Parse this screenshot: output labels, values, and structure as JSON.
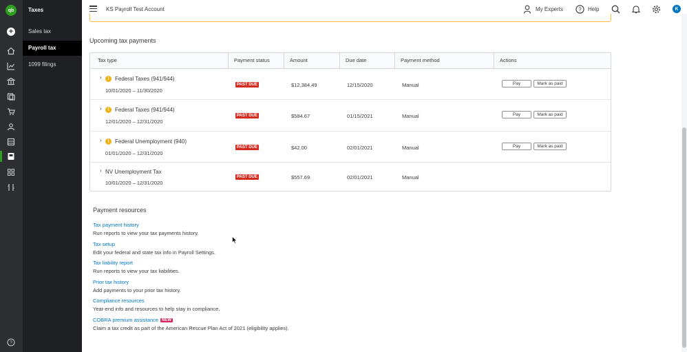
{
  "brand": {
    "logo_text": "qb",
    "logo_color": "#2ca01c"
  },
  "colors": {
    "accent": "#0077c5",
    "past_due": "#d52b1e",
    "new_badge": "#d6265e",
    "warning": "#f2b018"
  },
  "rail_icons": [
    "create-icon",
    "home-icon",
    "reports-icon",
    "bank-icon",
    "expenses-icon",
    "sales-icon",
    "customers-icon",
    "accounting-icon",
    "taxes-icon",
    "apps-icon",
    "tools-icon",
    "help-icon"
  ],
  "subnav": {
    "title": "Taxes",
    "items": [
      "Sales tax",
      "Payroll tax",
      "1099 filings"
    ],
    "active": "Payroll tax"
  },
  "header": {
    "company": "KS Payroll Test Account",
    "my_experts": "My Experts",
    "help": "Help",
    "avatar_initial": "K"
  },
  "upcoming": {
    "title": "Upcoming tax payments",
    "columns": [
      "Tax type",
      "Payment status",
      "Amount",
      "Due date",
      "Payment method",
      "Actions"
    ],
    "rows": [
      {
        "name": "Federal Taxes (941/944)",
        "range": "10/01/2020 – 11/30/2020",
        "status": "PAST DUE",
        "amount": "$12,384.49",
        "due": "12/15/2020",
        "method": "Manual",
        "pay": "Pay",
        "mark": "Mark as paid",
        "warning": true
      },
      {
        "name": "Federal Taxes (941/944)",
        "range": "12/01/2020 – 12/31/2020",
        "status": "PAST DUE",
        "amount": "$584.67",
        "due": "01/15/2021",
        "method": "Manual",
        "pay": "Pay",
        "mark": "Mark as paid",
        "warning": true
      },
      {
        "name": "Federal Unemployment (940)",
        "range": "01/01/2020 – 12/31/2020",
        "status": "PAST DUE",
        "amount": "$42.00",
        "due": "02/01/2021",
        "method": "Manual",
        "pay": "Pay",
        "mark": "Mark as paid",
        "warning": true
      },
      {
        "name": "NV Unemployment Tax",
        "range": "10/01/2020 – 12/31/2020",
        "status": "PAST DUE",
        "amount": "$557.69",
        "due": "02/01/2021",
        "method": "Manual",
        "warning": false
      }
    ]
  },
  "resources": {
    "title": "Payment resources",
    "items": [
      {
        "link": "Tax payment history",
        "desc": "Run reports to view your tax payments history."
      },
      {
        "link": "Tax setup",
        "desc": "Edit your federal and state tax info in Payroll Settings."
      },
      {
        "link": "Tax liability report",
        "desc": "Run reports to view your tax liabilities."
      },
      {
        "link": "Prior tax history",
        "desc": "Add payments to your prior tax history."
      },
      {
        "link": "Compliance resources",
        "desc": "Year-end info and resources to help stay in compliance."
      },
      {
        "link": "COBRA premium assistance",
        "badge": "NEW",
        "desc": "Claim a tax credit as part of the American Rescue Plan Act of 2021 (eligibility applies)."
      }
    ]
  }
}
